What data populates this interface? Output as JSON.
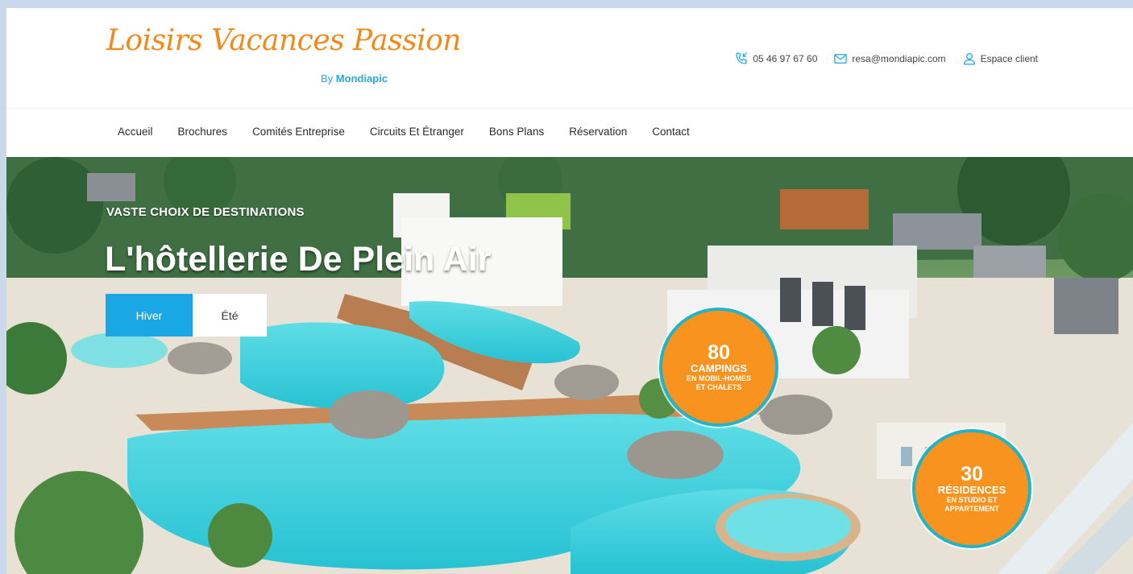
{
  "brand": {
    "logo_text": "Loisirs Vacances Passion",
    "logo_by": "By",
    "logo_sub": "Mondiapic",
    "logo_color": "#f08a1c",
    "sub_color": "#2aa6e0"
  },
  "contacts": {
    "phone": "05 46 97 67 60",
    "email": "resa@mondiapic.com",
    "account": "Espace client",
    "icon_color": "#1aa7e6"
  },
  "nav": {
    "items": [
      "Accueil",
      "Brochures",
      "Comités Entreprise",
      "Circuits Et Étranger",
      "Bons Plans",
      "Réservation",
      "Contact"
    ]
  },
  "hero": {
    "eyebrow": "VASTE CHOIX DE DESTINATIONS",
    "headline": "L'hôtellerie De Plein Air",
    "tabs": {
      "active": "Hiver",
      "inactive": "Été"
    },
    "accent_color": "#1aa7e6",
    "badges": [
      {
        "number": "80",
        "label": "CAMPINGS",
        "sub1": "EN MOBIL-HOMES",
        "sub2": "ET CHALETS"
      },
      {
        "number": "30",
        "label": "RÉSIDENCES",
        "sub1": "EN STUDIO ET",
        "sub2": "APPARTEMENT"
      }
    ],
    "badge_color": "#f7931e"
  }
}
